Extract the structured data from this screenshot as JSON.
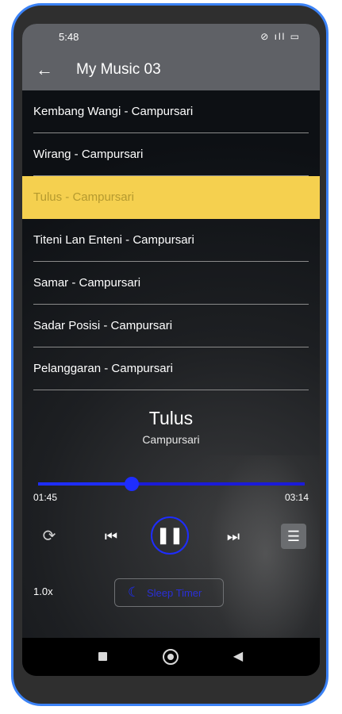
{
  "status": {
    "time": "5:48",
    "icons": "⊘ ıll ▭"
  },
  "header": {
    "back_icon": "←",
    "title": "My Music 03"
  },
  "playlist": [
    {
      "label": "Kembang Wangi - Campursari",
      "active": false
    },
    {
      "label": "Wirang - Campursari",
      "active": false
    },
    {
      "label": "Tulus - Campursari",
      "active": true
    },
    {
      "label": "Titeni Lan Enteni - Campursari",
      "active": false
    },
    {
      "label": "Samar - Campursari",
      "active": false
    },
    {
      "label": "Sadar Posisi - Campursari",
      "active": false
    },
    {
      "label": "Pelanggaran - Campursari",
      "active": false
    }
  ],
  "player": {
    "title": "Tulus",
    "artist": "Campursari",
    "current_time": "01:45",
    "total_time": "03:14",
    "progress": 0.35,
    "repeat_icon": "⟳",
    "prev_icon": "⏮",
    "pause_icon": "❚❚",
    "next_icon": "⏭",
    "playlist_icon": "☰",
    "speed": "1.0x",
    "sleep_icon": "☾",
    "sleep_label": "Sleep Timer"
  },
  "colors": {
    "accent": "#1e2dff",
    "active_row": "#f5d04f",
    "appbar": "#5f6166"
  },
  "navbar": {
    "back_icon": "◀"
  }
}
